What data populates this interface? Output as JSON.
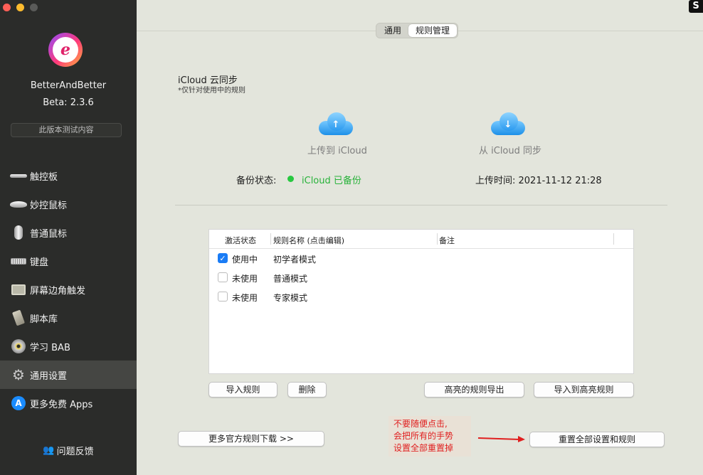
{
  "sidebar": {
    "app_name": "BetterAndBetter",
    "version": "Beta:  2.3.6",
    "beta_button": "此版本测试内容",
    "items": [
      {
        "label": "触控板",
        "icon": "trackpad-icon"
      },
      {
        "label": "妙控鼠标",
        "icon": "magic-mouse-icon"
      },
      {
        "label": "普通鼠标",
        "icon": "mouse-icon"
      },
      {
        "label": "键盘",
        "icon": "keyboard-icon"
      },
      {
        "label": "屏幕边角触发",
        "icon": "screen-corner-icon"
      },
      {
        "label": "脚本库",
        "icon": "script-icon"
      },
      {
        "label": "学习 BAB",
        "icon": "disc-icon"
      },
      {
        "label": "通用设置",
        "icon": "gear-icon",
        "active": true
      },
      {
        "label": "更多免费 Apps",
        "icon": "app-store-icon"
      }
    ],
    "feedback": "问题反馈"
  },
  "tabs": {
    "general": "通用",
    "rules": "规则管理",
    "active": "rules"
  },
  "icloud": {
    "title": "iCloud 云同步",
    "subtitle": "*仅针对使用中的规则",
    "upload_label": "上传到 iCloud",
    "sync_label": "从 iCloud 同步",
    "backup_label": "备份状态:",
    "backup_status": "iCloud 已备份",
    "upload_time": "上传时间:  2021-11-12   21:28"
  },
  "table": {
    "headers": {
      "status": "激活状态",
      "name": "规则名称 (点击编辑)",
      "note": "备注"
    },
    "rows": [
      {
        "checked": true,
        "status": "使用中",
        "name": "初学者模式",
        "note": ""
      },
      {
        "checked": false,
        "status": "未使用",
        "name": "普通模式",
        "note": ""
      },
      {
        "checked": false,
        "status": "未使用",
        "name": "专家模式",
        "note": ""
      }
    ]
  },
  "buttons": {
    "import_rules": "导入规则",
    "delete": "删除",
    "export_highlight": "高亮的规则导出",
    "import_to_highlight": "导入到高亮规则",
    "more_rules": "更多官方规则下载 >>",
    "reset_all": "重置全部设置和规则"
  },
  "warning": {
    "line1": "不要随便点击,",
    "line2": "会把所有的手势",
    "line3": "设置全部重置掉"
  },
  "colors": {
    "sidebar_bg": "#2b2c2a",
    "main_bg": "#e3e5dc",
    "success": "#28c840",
    "warning_text": "#e01f1f",
    "checkbox_accent": "#1a7cf5"
  }
}
